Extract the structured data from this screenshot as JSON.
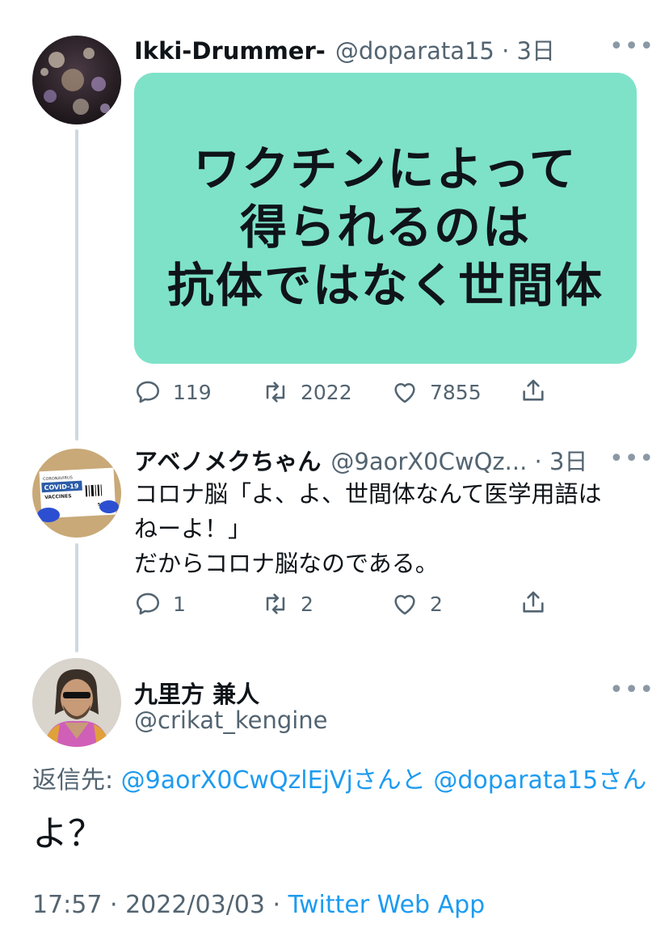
{
  "tweet1": {
    "name": "Ikki-Drummer-",
    "handle_time": "@doparata15 · 3日",
    "image_lines": [
      "ワクチンによって",
      "得られるのは",
      "抗体ではなく世間体"
    ],
    "replies": "119",
    "retweets": "2022",
    "likes": "7855"
  },
  "tweet2": {
    "name": "アベノメクちゃん",
    "handle_time": "@9aorX0CwQz... · 3日",
    "text_lines": [
      "コロナ脳「よ、よ、世間体なんて医学用語は",
      "ねーよ！」",
      "だからコロナ脳なのである。"
    ],
    "replies": "1",
    "retweets": "2",
    "likes": "2",
    "avatar_text": {
      "top": "CORONAVIRUS",
      "main": "COVID-19",
      "sub": "VACCINES",
      "dose": "500mL"
    }
  },
  "main": {
    "name": "九里方 兼人",
    "handle": "@crikat_kengine",
    "reply_prefix": "返信先: ",
    "reply_user1": "@9aorX0CwQzlEjVj",
    "reply_mid": "さんと",
    "reply_user2": "@doparata15",
    "reply_suffix": "さん",
    "text": "よ？",
    "time_date": "17:57 · 2022/03/03 · ",
    "client": "Twitter Web App"
  },
  "colors": {
    "accent": "#1d9bf0",
    "card": "#7ee2c8",
    "muted": "#536471"
  }
}
